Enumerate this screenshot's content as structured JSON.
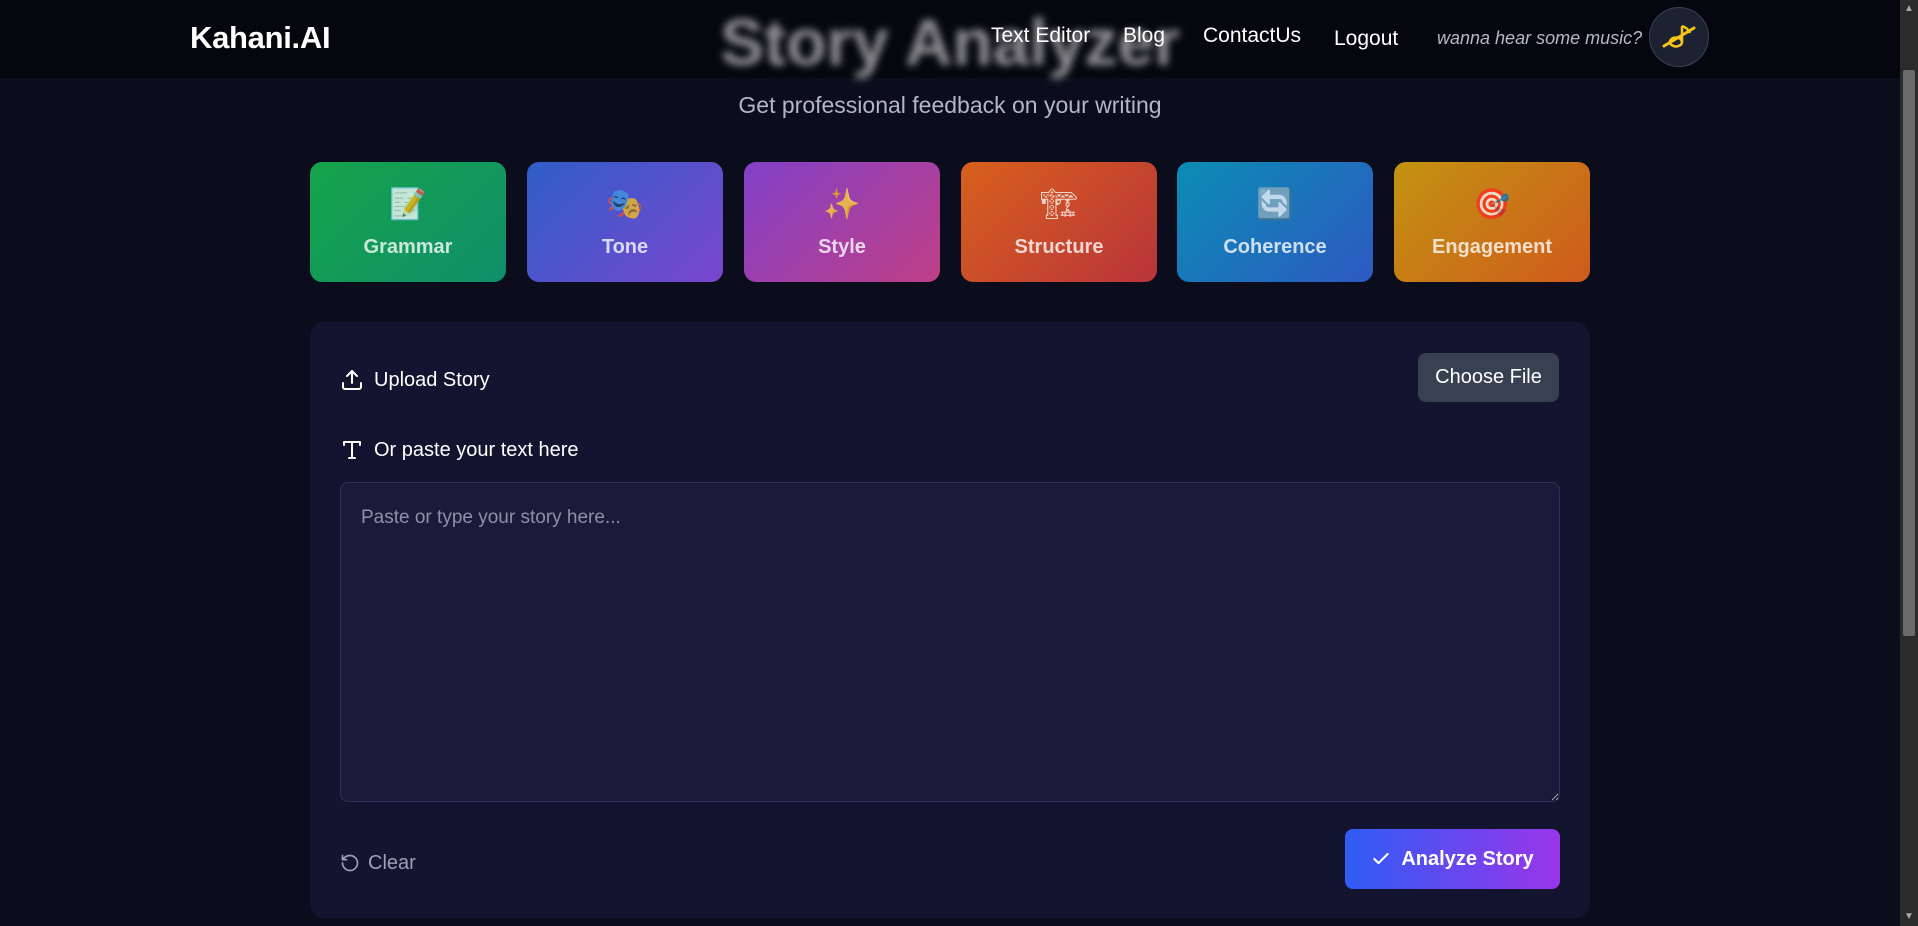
{
  "header": {
    "brand": "Kahani.AI",
    "hero_title": "Story Analyzer",
    "nav": {
      "text_editor": "Text Editor",
      "blog": "Blog",
      "contact": "ContactUs",
      "logout": "Logout"
    },
    "music_prompt": "wanna hear some music?",
    "music_icon": "muted-music-icon"
  },
  "subtitle": "Get professional feedback on your writing",
  "categories": [
    {
      "label": "Grammar",
      "icon": "📝",
      "icon_name": "memo-icon"
    },
    {
      "label": "Tone",
      "icon": "🎭",
      "icon_name": "masks-icon"
    },
    {
      "label": "Style",
      "icon": "✨",
      "icon_name": "sparkles-icon"
    },
    {
      "label": "Structure",
      "icon": "🏗",
      "icon_name": "building-icon"
    },
    {
      "label": "Coherence",
      "icon": "🔄",
      "icon_name": "refresh-icon"
    },
    {
      "label": "Engagement",
      "icon": "🎯",
      "icon_name": "target-icon"
    }
  ],
  "upload": {
    "label": "Upload Story",
    "choose_file": "Choose File"
  },
  "paste": {
    "label": "Or paste your text here",
    "placeholder": "Paste or type your story here...",
    "value": ""
  },
  "actions": {
    "clear": "Clear",
    "analyze": "Analyze Story"
  },
  "colors": {
    "background": "#0b0d1c",
    "panel": "#131530",
    "accent_start": "#2f5cf5",
    "accent_end": "#9a35ea"
  }
}
